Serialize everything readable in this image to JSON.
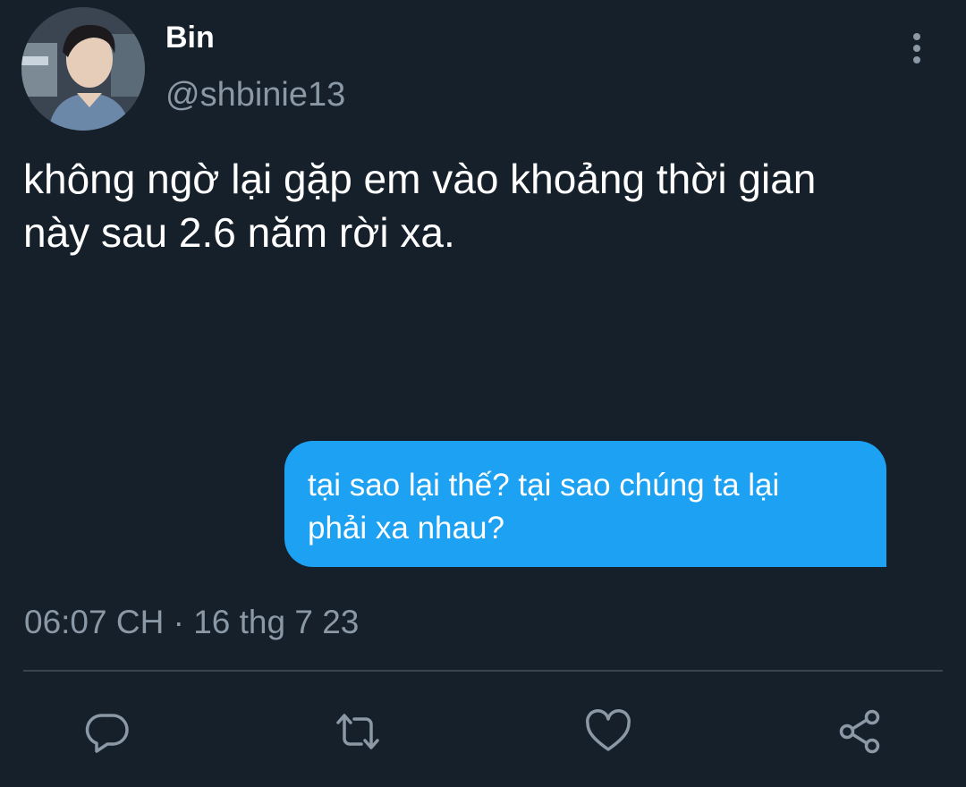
{
  "user": {
    "display_name": "Bin",
    "handle": "@shbinie13",
    "avatar_icon": "user-photo-avatar"
  },
  "tweet": {
    "text": "không ngờ lại gặp em vào khoảng thời gian\nnày sau 2.6 năm rời xa.",
    "bubble_text": "tại sao lại thế? tại sao chúng ta lại\nphải xa nhau?",
    "timestamp": "06:07 CH · 16 thg 7 23"
  },
  "actions": [
    {
      "name": "reply",
      "icon": "reply-bubble-icon"
    },
    {
      "name": "retweet",
      "icon": "retweet-icon"
    },
    {
      "name": "like",
      "icon": "heart-icon"
    },
    {
      "name": "share",
      "icon": "share-icon"
    }
  ],
  "colors": {
    "background": "#15202b",
    "accent_blue": "#1da1f2",
    "secondary_text": "#8b98a5",
    "divider": "#38444d"
  }
}
